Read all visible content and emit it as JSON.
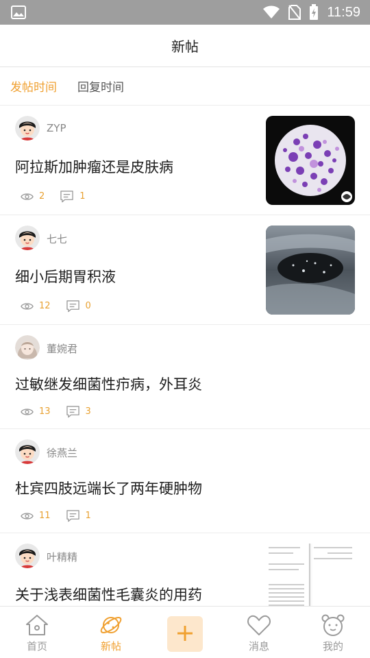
{
  "status_bar": {
    "time": "11:59"
  },
  "header": {
    "title": "新帖"
  },
  "tabs": [
    {
      "label": "发帖时间",
      "active": true
    },
    {
      "label": "回复时间",
      "active": false
    }
  ],
  "posts": [
    {
      "user": "ZYP",
      "title": "阿拉斯加肿瘤还是皮肤病",
      "views": "2",
      "comments": "1",
      "thumbnail": "microscope-slide"
    },
    {
      "user": "七七",
      "title": "细小后期胃积液",
      "views": "12",
      "comments": "0",
      "thumbnail": "ultrasound"
    },
    {
      "user": "董婉君",
      "title": "过敏继发细菌性疖病，外耳炎",
      "views": "13",
      "comments": "3",
      "thumbnail": ""
    },
    {
      "user": "徐燕兰",
      "title": "杜宾四肢远端长了两年硬肿物",
      "views": "11",
      "comments": "1",
      "thumbnail": ""
    },
    {
      "user": "叶精精",
      "title": "关于浅表细菌性毛囊炎的用药",
      "views": "",
      "comments": "",
      "thumbnail": "lab-report"
    }
  ],
  "bottom_nav": [
    {
      "label": "首页",
      "icon": "home-icon",
      "active": false
    },
    {
      "label": "新帖",
      "icon": "planet-icon",
      "active": true
    },
    {
      "label": "",
      "icon": "plus-icon",
      "active": false
    },
    {
      "label": "消息",
      "icon": "heart-icon",
      "active": false
    },
    {
      "label": "我的",
      "icon": "bear-face-icon",
      "active": false
    }
  ],
  "colors": {
    "accent": "#f0a030",
    "status_bar": "#9e9e9e",
    "muted_text": "#888888"
  }
}
